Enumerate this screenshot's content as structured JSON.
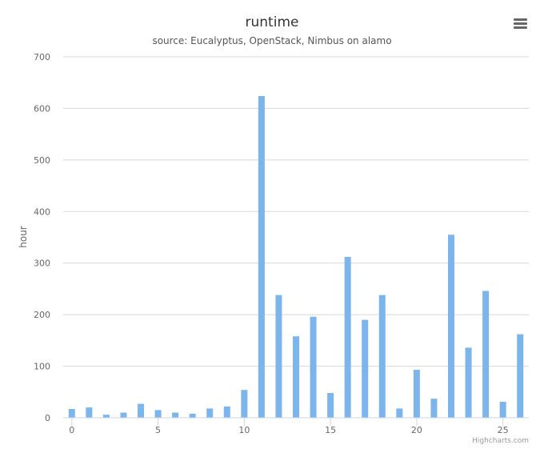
{
  "chart_data": {
    "type": "bar",
    "title": "runtime",
    "subtitle": "source: Eucalyptus, OpenStack, Nimbus on alamo",
    "xlabel": "",
    "ylabel": "hour",
    "x": [
      0,
      1,
      2,
      3,
      4,
      5,
      6,
      7,
      8,
      9,
      10,
      11,
      12,
      13,
      14,
      15,
      16,
      17,
      18,
      19,
      20,
      21,
      22,
      23,
      24,
      25,
      26
    ],
    "values": [
      17,
      20,
      6,
      10,
      27,
      15,
      10,
      8,
      18,
      22,
      54,
      624,
      238,
      158,
      196,
      48,
      312,
      190,
      238,
      18,
      93,
      37,
      355,
      136,
      246,
      31,
      162
    ],
    "x_ticks": [
      0,
      5,
      10,
      15,
      20,
      25
    ],
    "y_ticks": [
      0,
      100,
      200,
      300,
      400,
      500,
      600,
      700
    ],
    "ylim": [
      0,
      700
    ],
    "xlim": [
      -0.5,
      26.5
    ],
    "grid": true,
    "legend": "none",
    "bar_color": "#7cb5ec",
    "grid_color": "#d8d8d8",
    "credits": "Highcharts.com",
    "menu_icon": "hamburger-menu-icon"
  }
}
